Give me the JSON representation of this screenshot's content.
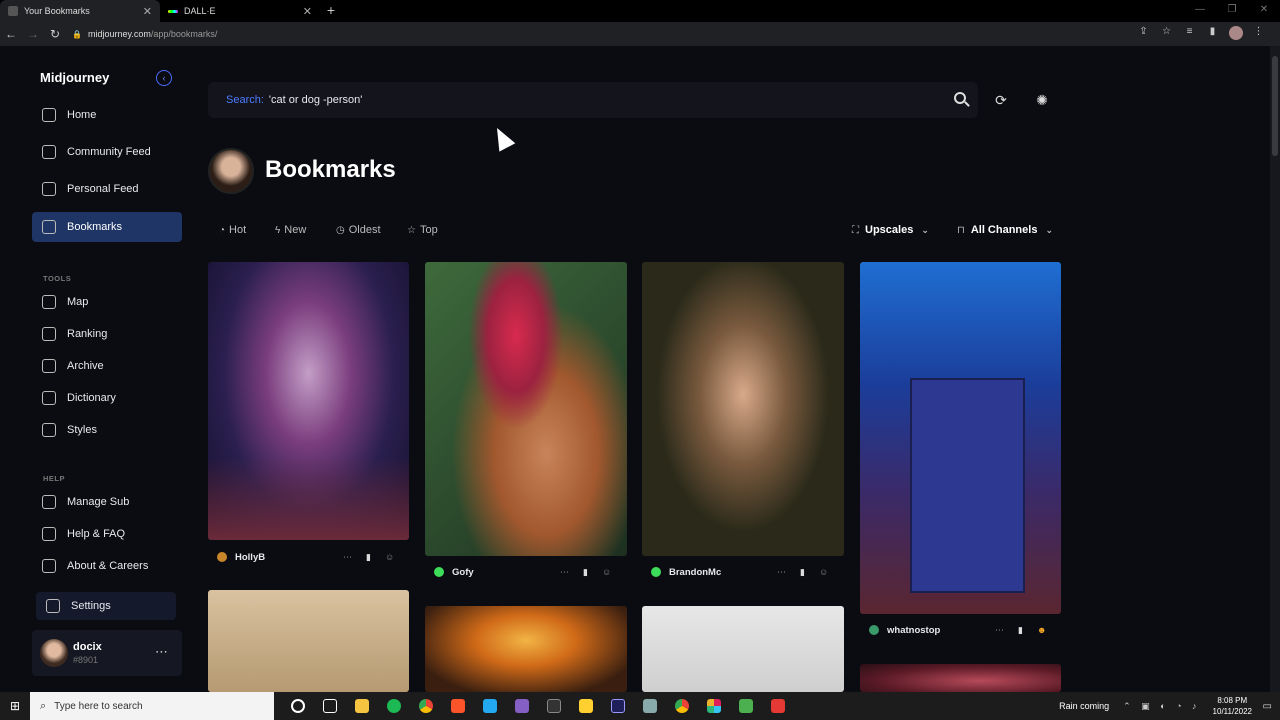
{
  "browser": {
    "tabs": [
      {
        "label": "Your Bookmarks",
        "active": true
      },
      {
        "label": "DALL·E",
        "active": false
      }
    ],
    "url_host": "midjourney.com",
    "url_path": "/app/bookmarks/"
  },
  "sidebar": {
    "brand": "Midjourney",
    "items": [
      {
        "label": "Home"
      },
      {
        "label": "Community Feed"
      },
      {
        "label": "Personal Feed"
      },
      {
        "label": "Bookmarks"
      }
    ],
    "tools_heading": "TOOLS",
    "tools": [
      {
        "label": "Map"
      },
      {
        "label": "Ranking"
      },
      {
        "label": "Archive"
      },
      {
        "label": "Dictionary"
      },
      {
        "label": "Styles"
      }
    ],
    "help_heading": "HELP",
    "help": [
      {
        "label": "Manage Sub"
      },
      {
        "label": "Help & FAQ"
      },
      {
        "label": "About & Careers"
      }
    ],
    "settings_label": "Settings",
    "user": {
      "name": "docix",
      "tag": "#8901"
    }
  },
  "search": {
    "label": "Search:",
    "value": "'cat or dog -person'"
  },
  "page_title": "Bookmarks",
  "sort": {
    "hot": "Hot",
    "new": "New",
    "oldest": "Oldest",
    "top": "Top"
  },
  "filters": {
    "upscales": "Upscales",
    "channels": "All Channels"
  },
  "cards": [
    {
      "user": "HollyB",
      "dot": "#c8862a"
    },
    {
      "user": "Gofy",
      "dot": "#3ddc5a"
    },
    {
      "user": "BrandonMc",
      "dot": "#3ddc5a"
    },
    {
      "user": "whatnostop",
      "dot": "#3a9a6a"
    }
  ],
  "taskbar": {
    "search_placeholder": "Type here to search",
    "weather": "Rain coming",
    "time": "8:08 PM",
    "date": "10/11/2022"
  }
}
